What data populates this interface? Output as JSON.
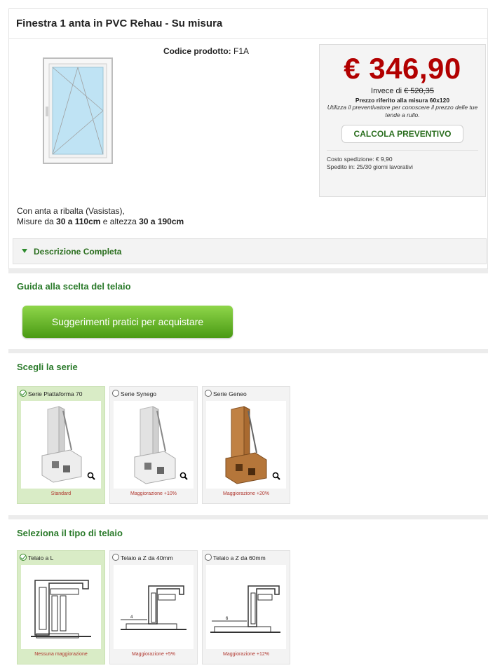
{
  "product": {
    "title": "Finestra 1 anta in PVC Rehau - Su misura",
    "code_label": "Codice prodotto:",
    "code_value": "F1A",
    "desc_line1": "Con anta a ribalta (Vasistas),",
    "desc_line2_a": "Misure da ",
    "desc_line2_b": "30 a 110cm",
    "desc_line2_c": " e altezza ",
    "desc_line2_d": "30 a 190cm",
    "full_description_label": "Descrizione Completa"
  },
  "pricebox": {
    "price": "€ 346,90",
    "invece_label": "Invece di ",
    "old_price": "€ 520,35",
    "reference": "Prezzo riferito alla misura 60x120",
    "hint": "Utilizza il preventivatore per conoscere il prezzo delle tue tende a rullo.",
    "calc_button": "CALCOLA PREVENTIVO",
    "shipping_cost": "Costo spedizione: € 9,90",
    "shipping_time": "Spedito in: 25/30 giorni lavorativi"
  },
  "guide": {
    "heading": "Guida alla scelta del telaio",
    "button": "Suggerimenti pratici per acquistare"
  },
  "series": {
    "heading": "Scegli la serie",
    "options": [
      {
        "label": "Serie Piattaforma 70",
        "footer": "Standard",
        "selected": true,
        "color": "#e8e8e8"
      },
      {
        "label": "Serie Synego",
        "footer": "Maggiorazione +10%",
        "selected": false,
        "color": "#e8e8e8"
      },
      {
        "label": "Serie Geneo",
        "footer": "Maggiorazione +20%",
        "selected": false,
        "color": "#b5763a"
      }
    ]
  },
  "frame": {
    "heading": "Seleziona il tipo di telaio",
    "options": [
      {
        "label": "Telaio a L",
        "footer": "Nessuna maggiorazione",
        "selected": true
      },
      {
        "label": "Telaio a Z da 40mm",
        "footer": "Maggiorazione +5%",
        "selected": false
      },
      {
        "label": "Telaio a Z da 60mm",
        "footer": "Maggiorazione +12%",
        "selected": false
      }
    ]
  },
  "colors": {
    "accent_green": "#2a7a2a",
    "price_red": "#b20000",
    "selected_card": "#d9ecc6"
  }
}
